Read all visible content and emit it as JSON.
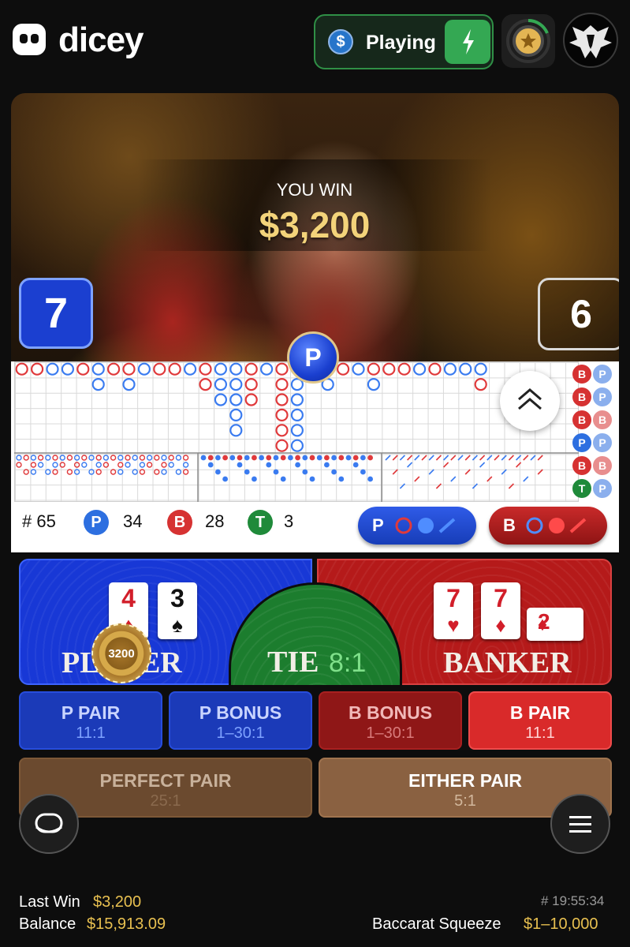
{
  "header": {
    "brand": "dicey",
    "status_label": "Playing",
    "currency_icon": "$"
  },
  "video": {
    "win_label": "YOU WIN",
    "win_amount": "$3,200",
    "player_score": "7",
    "banker_score": "6",
    "result_marker": "P"
  },
  "roads": {
    "stats": {
      "rounds_label": "# 65",
      "player_letter": "P",
      "player_count": "34",
      "banker_letter": "B",
      "banker_count": "28",
      "tie_letter": "T",
      "tie_count": "3"
    },
    "ask_player_letter": "P",
    "ask_banker_letter": "B",
    "prediction": [
      {
        "left": "B",
        "right": "P"
      },
      {
        "left": "B",
        "right": "P"
      },
      {
        "left": "B",
        "right": "B"
      },
      {
        "left": "P",
        "right": "P"
      },
      {
        "left": "B",
        "right": "B"
      },
      {
        "left": "T",
        "right": "P"
      }
    ]
  },
  "table": {
    "player_label": "PLAYER",
    "banker_label": "BANKER",
    "tie_label": "TIE",
    "tie_odds": "8:1",
    "player_cards": [
      {
        "rank": "4",
        "suit": "♦",
        "color": "red"
      },
      {
        "rank": "3",
        "suit": "♠",
        "color": "black"
      }
    ],
    "banker_cards": [
      {
        "rank": "7",
        "suit": "♥",
        "color": "red"
      },
      {
        "rank": "7",
        "suit": "♦",
        "color": "red"
      },
      {
        "rank": "2",
        "suit": "♦",
        "color": "red"
      }
    ],
    "chip_value": "3200",
    "side_bets": [
      {
        "label": "P PAIR",
        "odds": "11:1"
      },
      {
        "label": "P BONUS",
        "odds": "1–30:1"
      },
      {
        "label": "B BONUS",
        "odds": "1–30:1"
      },
      {
        "label": "B PAIR",
        "odds": "11:1"
      }
    ],
    "perfect_pair": {
      "label": "PERFECT PAIR",
      "odds": "25:1"
    },
    "either_pair": {
      "label": "EITHER PAIR",
      "odds": "5:1"
    }
  },
  "footer": {
    "last_win_label": "Last Win",
    "last_win_value": "$3,200",
    "balance_label": "Balance",
    "balance_value": "$15,913.09",
    "round_id": "# 19:55:34",
    "game_name": "Baccarat Squeeze",
    "limits": "$1–10,000"
  },
  "colors": {
    "player_blue": "#1838d6",
    "banker_red": "#b51a1a",
    "tie_green": "#1c7d2e",
    "accent_gold": "#e8c050",
    "status_green": "#34a853"
  }
}
